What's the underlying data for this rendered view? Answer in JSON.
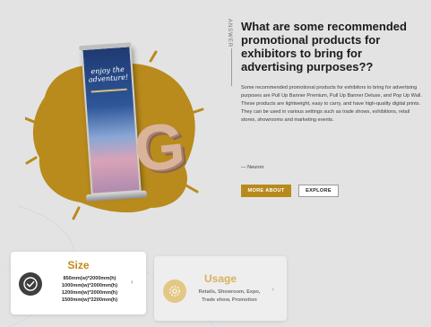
{
  "answer": {
    "side_label": "ANSWER",
    "question": "What are some recommended promotional products for exhibitors to bring for advertising purposes??",
    "body": "Some recommended promotional products for exhibitors to bring for advertising purposes are Pull Up Banner Premium, Pull Up Banner Deluxe, and Pop Up Wall. These products are lightweight, easy to carry, and have high-quality digital prints. They can be used in various settings such as trade shows, exhibitions, retail stores, showrooms and marketing events.",
    "author": "— Neuron",
    "more_label": "MORE ABOUT",
    "explore_label": "EXPLORE"
  },
  "hero": {
    "banner_text": "enjoy the adventure!",
    "logo_letter": "G"
  },
  "cards": {
    "size": {
      "title": "Size",
      "icon": "checkmark-circle-icon",
      "items": [
        "850mm(w)*2000mm(h)",
        "1000mm(w)*2000mm(h)",
        "1200mm(w)*2000mm(h)",
        "1500mm(w)*2200mm(h)"
      ],
      "chevron": "›"
    },
    "usage": {
      "title": "Usage",
      "icon": "gear-icon",
      "text": "Retails, Showroom, Expo, Trade show, Promotion",
      "chevron": "›"
    }
  },
  "colors": {
    "accent": "#b88a1c",
    "background": "#e3e3e3",
    "card": "#ffffff"
  }
}
